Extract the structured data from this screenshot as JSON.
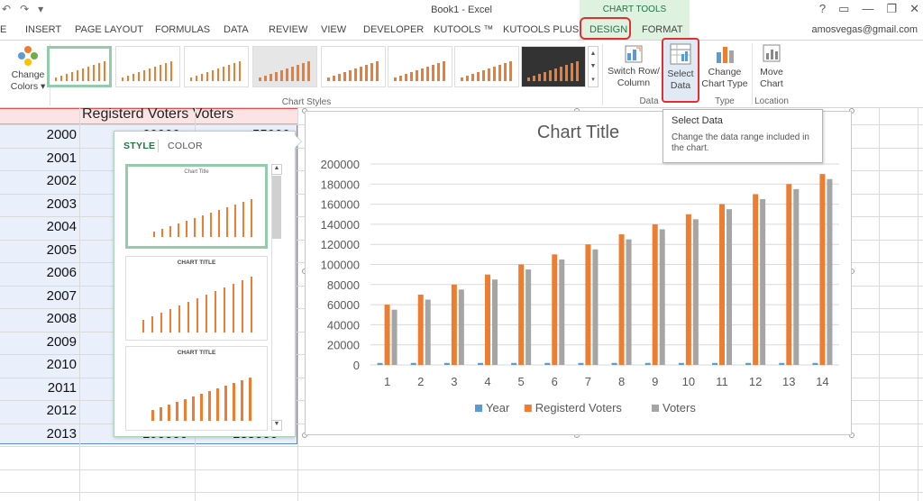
{
  "window": {
    "title": "Book1 - Excel",
    "chart_tools": "CHART TOOLS",
    "account": "amosvegas@gmail.com",
    "help": "?",
    "minimize": "—",
    "restore": "❐",
    "close": "✕",
    "ribbon_opts": "▭"
  },
  "qat": {
    "undo": "↶",
    "redo": "↷",
    "save": "▾"
  },
  "tabs": [
    {
      "label": "E"
    },
    {
      "label": "INSERT"
    },
    {
      "label": "PAGE LAYOUT"
    },
    {
      "label": "FORMULAS"
    },
    {
      "label": "DATA"
    },
    {
      "label": "REVIEW"
    },
    {
      "label": "VIEW"
    },
    {
      "label": "DEVELOPER"
    },
    {
      "label": "KUTOOLS ™"
    },
    {
      "label": "KUTOOLS PLUS"
    },
    {
      "label": "DESIGN"
    },
    {
      "label": "FORMAT"
    }
  ],
  "ribbon": {
    "change_colors": [
      "Change",
      "Colors ▾"
    ],
    "chart_styles_label": "Chart Styles",
    "switch_row": [
      "Switch Row/",
      "Column"
    ],
    "select_data": [
      "Select",
      "Data"
    ],
    "data_label": "Data",
    "change_type": [
      "Change",
      "Chart Type"
    ],
    "type_label": "Type",
    "move_chart": [
      "Move",
      "Chart"
    ],
    "location_label": "Location"
  },
  "tooltip": {
    "title": "Select Data",
    "body": "Change the data range included in the chart."
  },
  "sheet": {
    "header": "Registerd Voters Voters",
    "years": [
      "2000",
      "2001",
      "2002",
      "2003",
      "2004",
      "2005",
      "2006",
      "2007",
      "2008",
      "2009",
      "2010",
      "2011",
      "2012",
      "2013"
    ],
    "partial_values": {
      "r0_b": "60000",
      "r0_c": "55000",
      "r13_b": "190000",
      "r13_c": "185000"
    }
  },
  "flyout": {
    "tab_style": "STYLE",
    "tab_color": "COLOR",
    "thumb_titles": [
      "Chart Title",
      "CHART TITLE",
      "CHART TITLE"
    ]
  },
  "chart_data": {
    "type": "bar",
    "title": "Chart Title",
    "categories": [
      "1",
      "2",
      "3",
      "4",
      "5",
      "6",
      "7",
      "8",
      "9",
      "10",
      "11",
      "12",
      "13",
      "14"
    ],
    "ylim": [
      0,
      200000
    ],
    "yticks": [
      "0",
      "20000",
      "40000",
      "60000",
      "80000",
      "100000",
      "120000",
      "140000",
      "160000",
      "180000",
      "200000"
    ],
    "grid": true,
    "legend": "bottom",
    "series": [
      {
        "name": "Year",
        "color": "#5b9bd5",
        "values": [
          2000,
          2001,
          2002,
          2003,
          2004,
          2005,
          2006,
          2007,
          2008,
          2009,
          2010,
          2011,
          2012,
          2013
        ]
      },
      {
        "name": "Registerd Voters",
        "color": "#ed7d31",
        "values": [
          60000,
          70000,
          80000,
          90000,
          100000,
          110000,
          120000,
          130000,
          140000,
          150000,
          160000,
          170000,
          180000,
          190000
        ]
      },
      {
        "name": "Voters",
        "color": "#a5a5a5",
        "values": [
          55000,
          65000,
          75000,
          85000,
          95000,
          105000,
          115000,
          125000,
          135000,
          145000,
          155000,
          165000,
          175000,
          185000
        ]
      }
    ]
  }
}
